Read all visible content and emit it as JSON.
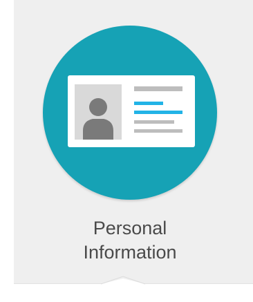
{
  "tile": {
    "label_line1": "Personal",
    "label_line2": "Information",
    "icon": "id-card-icon",
    "colors": {
      "tile_background": "#efefef",
      "circle": "#16a2b5",
      "card": "#ffffff",
      "photo_background": "#d9d9d9",
      "avatar": "#7a7a7a",
      "text_lines_gray": "#bdbdbd",
      "text_lines_accent": "#22b3e6",
      "label_text": "#4a4a4a"
    }
  }
}
